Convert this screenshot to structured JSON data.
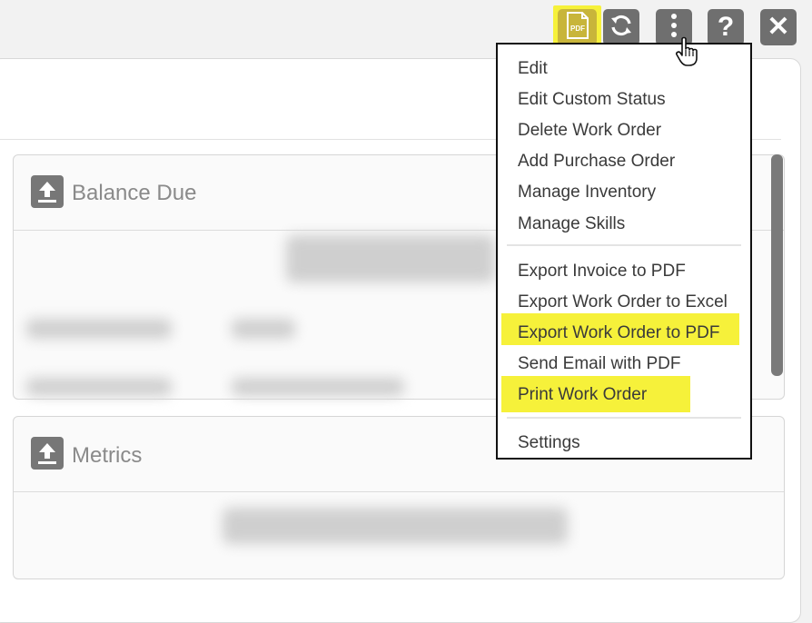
{
  "toolbar": {
    "buttons": [
      {
        "name": "pdf",
        "icon": "pdf-file-icon",
        "label": "PDF"
      },
      {
        "name": "refresh",
        "icon": "refresh-icon"
      },
      {
        "name": "more",
        "icon": "more-vertical-icon"
      },
      {
        "name": "help",
        "icon": "help-icon",
        "glyph": "?"
      },
      {
        "name": "close",
        "icon": "close-icon",
        "glyph": "✕"
      }
    ]
  },
  "cards": [
    {
      "title": "Balance Due",
      "icon": "upload-icon"
    },
    {
      "title": "Metrics",
      "icon": "upload-icon"
    }
  ],
  "menu": {
    "items": [
      "Edit",
      "Edit Custom Status",
      "Delete Work Order",
      "Add Purchase Order",
      "Manage Inventory",
      "Manage Skills",
      "Export Invoice to PDF",
      "Export Work Order to Excel",
      "Export Work Order to PDF",
      "Send Email with PDF",
      "Print Work Order",
      "Settings"
    ],
    "highlighted": [
      "Export Work Order to PDF",
      "Print Work Order"
    ]
  },
  "colors": {
    "highlight": "#f6f13a",
    "toolbar_button": "#6f6f6f",
    "menu_border": "#111111"
  }
}
